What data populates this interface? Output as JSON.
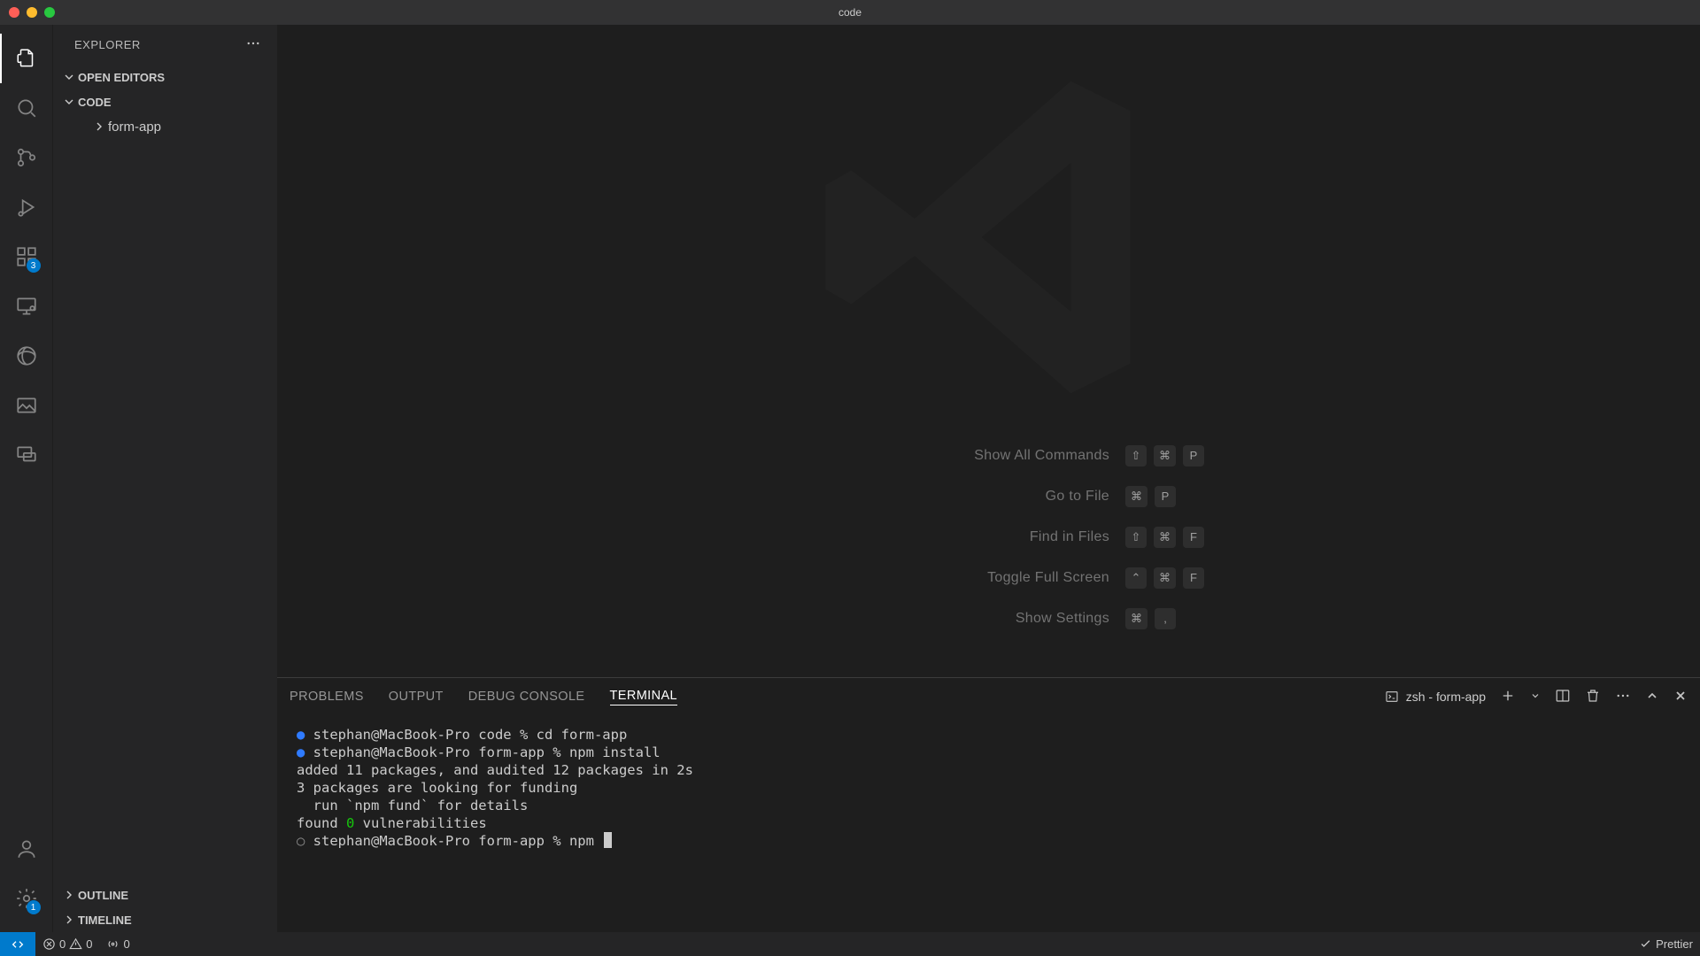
{
  "titlebar": {
    "title": "code"
  },
  "activity": {
    "extensions_badge": "3",
    "settings_badge": "1"
  },
  "sidebar": {
    "header": "EXPLORER",
    "open_editors": "OPEN EDITORS",
    "workspace": "CODE",
    "tree": {
      "folder": "form-app"
    },
    "outline": "OUTLINE",
    "timeline": "TIMELINE"
  },
  "shortcuts": [
    {
      "label": "Show All Commands",
      "keys": [
        "⇧",
        "⌘",
        "P"
      ]
    },
    {
      "label": "Go to File",
      "keys": [
        "⌘",
        "P"
      ]
    },
    {
      "label": "Find in Files",
      "keys": [
        "⇧",
        "⌘",
        "F"
      ]
    },
    {
      "label": "Toggle Full Screen",
      "keys": [
        "⌃",
        "⌘",
        "F"
      ]
    },
    {
      "label": "Show Settings",
      "keys": [
        "⌘",
        ","
      ]
    }
  ],
  "panel": {
    "tabs": {
      "problems": "PROBLEMS",
      "output": "OUTPUT",
      "debug": "DEBUG CONSOLE",
      "terminal": "TERMINAL"
    },
    "terminal_name": "zsh - form-app"
  },
  "terminal": {
    "lines": [
      {
        "dot": "●",
        "dot_class": "term-dot",
        "text": " stephan@MacBook-Pro code % cd form-app"
      },
      {
        "dot": "●",
        "dot_class": "term-dot",
        "text": " stephan@MacBook-Pro form-app % npm install"
      },
      {
        "text": ""
      },
      {
        "text": "added 11 packages, and audited 12 packages in 2s"
      },
      {
        "text": ""
      },
      {
        "text": "3 packages are looking for funding"
      },
      {
        "text": "  run `npm fund` for details"
      },
      {
        "text": ""
      },
      {
        "segments": [
          {
            "t": "found "
          },
          {
            "t": "0",
            "c": "term-green"
          },
          {
            "t": " vulnerabilities"
          }
        ]
      },
      {
        "dot": "○",
        "dot_class": "term-dot-open",
        "text": " stephan@MacBook-Pro form-app % npm ",
        "cursor": true
      }
    ]
  },
  "status": {
    "errors": "0",
    "warnings": "0",
    "ports": "0",
    "prettier": "Prettier"
  }
}
